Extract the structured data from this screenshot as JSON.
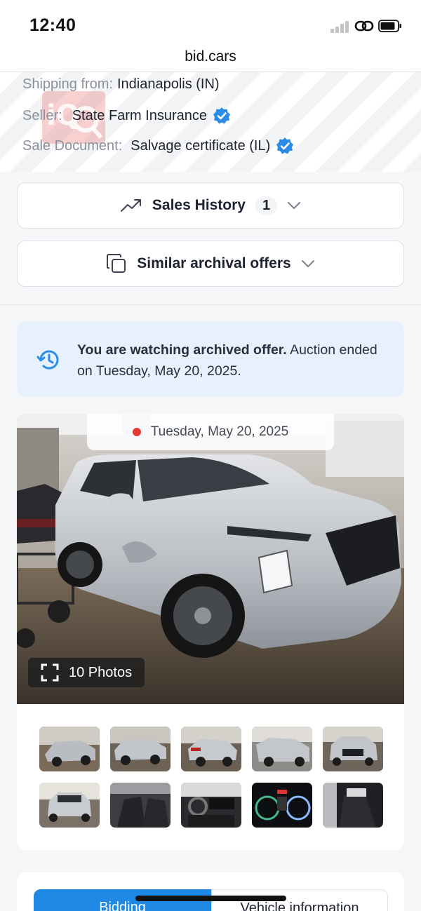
{
  "status_bar": {
    "time": "12:40"
  },
  "browser": {
    "url": "bid.cars"
  },
  "vehicle_info": {
    "shipping_label": "Shipping from:",
    "shipping_value": "Indianapolis (IN)",
    "seller_label": "Seller:",
    "seller_value": "State Farm Insurance",
    "sale_document_label": "Sale Document:",
    "sale_document_value": "Salvage certificate (IL)",
    "verified_icon": "verified-badge-icon"
  },
  "sections": {
    "sales_history_label": "Sales History",
    "sales_history_count": "1",
    "similar_offers_label": "Similar archival offers"
  },
  "notice": {
    "bold_text": "You are watching archived offer.",
    "rest_text": "Auction ended on Tuesday, May 20, 2025."
  },
  "gallery": {
    "date": "Tuesday, May 20, 2025",
    "photos_label": "10 Photos",
    "thumbnails": [
      "front-left exterior",
      "rear-left exterior",
      "rear-right exterior",
      "front-right exterior",
      "front exterior",
      "rear exterior",
      "interior front seats",
      "dashboard",
      "instrument cluster",
      "interior rear seats"
    ]
  },
  "tabs": {
    "bidding_label": "Bidding",
    "vehicle_info_label": "Vehicle information"
  },
  "colors": {
    "accent": "#1e88e5",
    "verified": "#2b8ce8",
    "notice_bg": "#e6f1fd",
    "live_dot": "#e53935"
  }
}
